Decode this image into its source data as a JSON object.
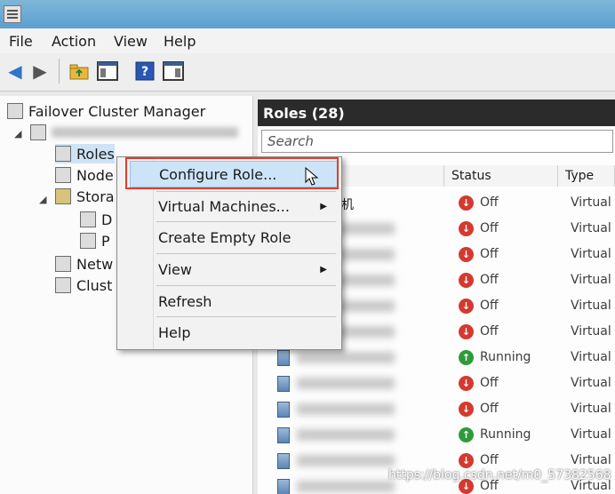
{
  "menubar": {
    "file": "File",
    "action": "Action",
    "view": "View",
    "help": "Help"
  },
  "toolbar": {
    "buttons": [
      "back-icon",
      "forward-icon",
      "up-folder-icon",
      "show-hide-console-tree-icon",
      "help-icon",
      "show-hide-action-pane-icon"
    ]
  },
  "tree": {
    "root": "Failover Cluster Manager",
    "roles": "Roles",
    "nodes": "Node",
    "storage": "Stora",
    "disks": "D",
    "pools": "P",
    "networks": "Netw",
    "cluster_events": "Clust"
  },
  "main": {
    "header": "Roles (28)",
    "search_placeholder": "Search",
    "columns": {
      "status": "Status",
      "type": "Type"
    },
    "first_row_name_fragment": "拟机",
    "rows": [
      {
        "status": "Off",
        "type": "Virtual M"
      },
      {
        "status": "Off",
        "type": "Virtual M"
      },
      {
        "status": "Off",
        "type": "Virtual M"
      },
      {
        "status": "Off",
        "type": "Virtual M"
      },
      {
        "status": "Off",
        "type": "Virtual M"
      },
      {
        "status": "Off",
        "type": "Virtual M"
      },
      {
        "status": "Running",
        "type": "Virtual M"
      },
      {
        "status": "Off",
        "type": "Virtual M"
      },
      {
        "status": "Off",
        "type": "Virtual M"
      },
      {
        "status": "Running",
        "type": "Virtual M"
      },
      {
        "status": "Off",
        "type": "Virtual M"
      },
      {
        "status": "Off",
        "type": "Virtual M"
      }
    ]
  },
  "context_menu": {
    "configure_role": "Configure Role...",
    "virtual_machines": "Virtual Machines...",
    "create_empty_role": "Create Empty Role",
    "view": "View",
    "refresh": "Refresh",
    "help": "Help"
  },
  "watermark": "https://blog.csdn.net/m0_57382568",
  "colors": {
    "highlight": "#e53b2a",
    "status_off": "#d43a2f",
    "status_running": "#2f9a3a"
  }
}
